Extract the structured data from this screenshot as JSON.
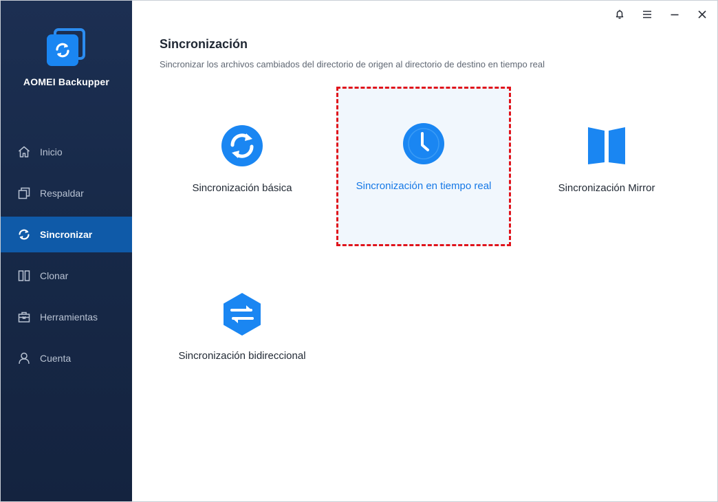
{
  "app": {
    "name": "AOMEI Backupper"
  },
  "sidebar": {
    "items": [
      {
        "label": "Inicio",
        "icon": "home-icon",
        "active": false
      },
      {
        "label": "Respaldar",
        "icon": "backup-icon",
        "active": false
      },
      {
        "label": "Sincronizar",
        "icon": "sync-icon",
        "active": true
      },
      {
        "label": "Clonar",
        "icon": "clone-icon",
        "active": false
      },
      {
        "label": "Herramientas",
        "icon": "toolbox-icon",
        "active": false
      },
      {
        "label": "Cuenta",
        "icon": "user-icon",
        "active": false
      }
    ]
  },
  "titlebar": {
    "icons": [
      "bell-icon",
      "menu-icon",
      "minimize-icon",
      "close-icon"
    ]
  },
  "main": {
    "title": "Sincronización",
    "subtitle": "Sincronizar los archivos cambiados del directorio de origen al directorio de destino en tiempo real",
    "options": [
      {
        "label": "Sincronización básica",
        "icon": "basic-sync-icon",
        "selected": false
      },
      {
        "label": "Sincronización en tiempo real",
        "icon": "clock-icon",
        "selected": true
      },
      {
        "label": "Sincronización Mirror",
        "icon": "mirror-icon",
        "selected": false
      },
      {
        "label": "Sincronización bidireccional",
        "icon": "two-way-sync-icon",
        "selected": false
      }
    ]
  },
  "colors": {
    "sidebar": "#172948",
    "active_nav": "#0f5aa8",
    "accent": "#1578e6",
    "highlight_border": "#e0131b"
  }
}
